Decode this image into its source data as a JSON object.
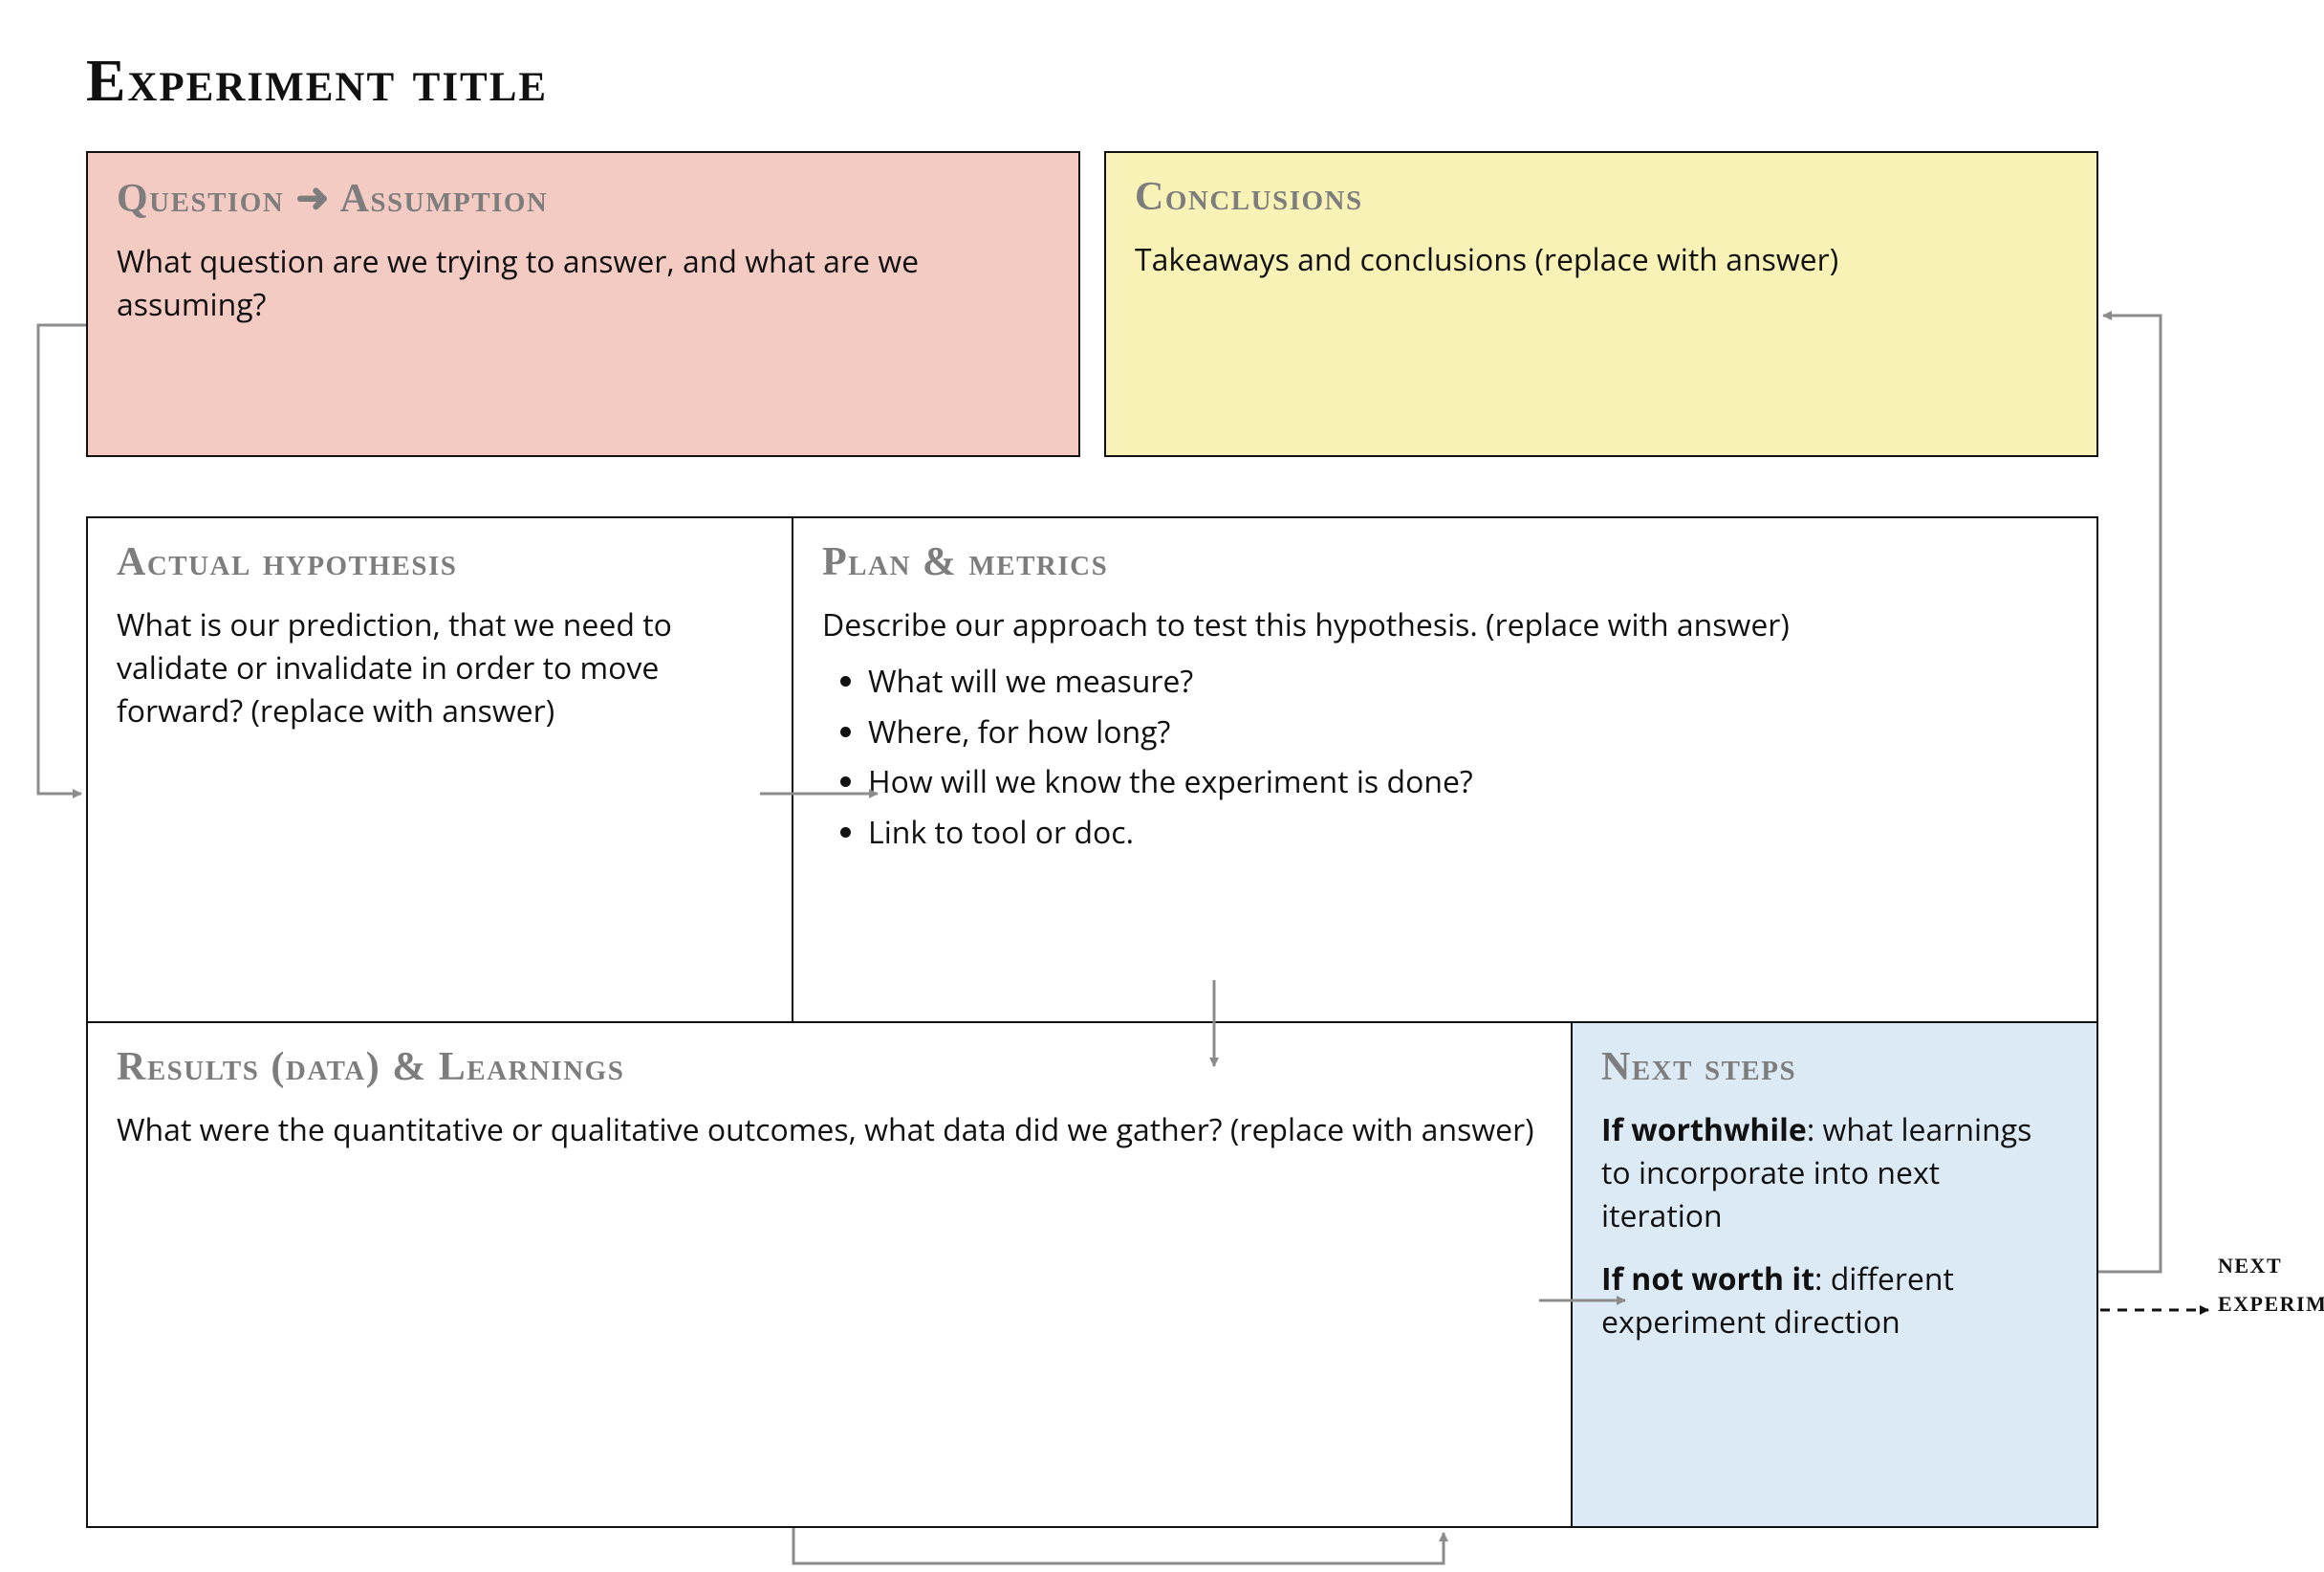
{
  "page_title": "Experiment title",
  "boxes": {
    "question": {
      "title_left": "Question",
      "title_right": "Assumption",
      "body": "What question are we trying to answer, and what are we assuming?"
    },
    "conclusions": {
      "title": "Conclusions",
      "body": "Takeaways and conclusions (replace with answer)"
    },
    "hypothesis": {
      "title": "Actual hypothesis",
      "body": "What is our prediction, that we need to validate or invalidate in order to move forward? (replace with answer)"
    },
    "plan": {
      "title": "Plan & metrics",
      "lead": "Describe our approach to test this hypothesis. (replace with answer)",
      "bullets": [
        "What will we measure?",
        "Where, for how long?",
        "How will we know the experiment is done?",
        "Link to tool or doc."
      ]
    },
    "results": {
      "title": "Results (data) & Learnings",
      "body": "What were the quantitative or qualitative outcomes, what data did we gather? (replace with answer)"
    },
    "next": {
      "title": "Next steps",
      "worth_label": "If worthwhile",
      "worth_text": ": what learnings to incorporate into next iteration",
      "notworth_label": "If not worth it",
      "notworth_text": ": different experiment direction"
    }
  },
  "outside": {
    "next_experiment_line1": "next",
    "next_experiment_line2": "experiment"
  }
}
